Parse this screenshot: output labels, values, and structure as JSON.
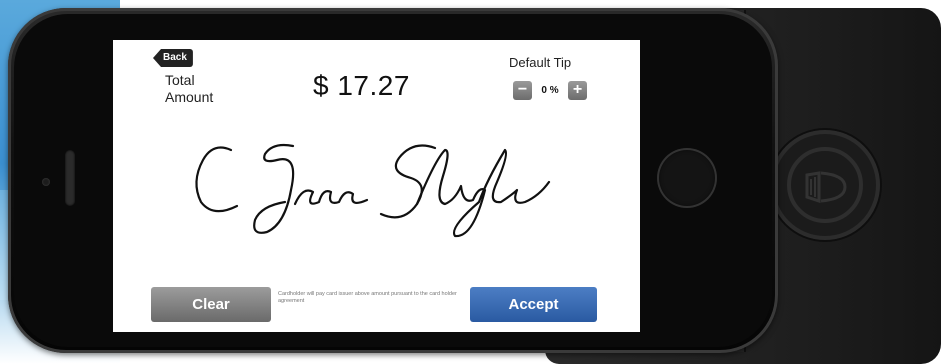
{
  "header": {
    "back_label": "Back",
    "total_label": "Total Amount",
    "amount": "$ 17.27",
    "tip_label": "Default Tip",
    "tip_value": "0 %",
    "tip_minus": "−",
    "tip_plus": "+"
  },
  "signature": {
    "text": "C Jane Slyde"
  },
  "footer": {
    "clear_label": "Clear",
    "accept_label": "Accept",
    "notice": "Cardholder will pay card issuer above amount pursuant to the card holder agreement"
  },
  "colors": {
    "accept": "#2a5aa2",
    "clear": "#6a6a6a",
    "phone": "#111111",
    "reader": "#1f1f1f"
  },
  "icons": [
    "reader-logo-icon",
    "home-button-icon"
  ]
}
